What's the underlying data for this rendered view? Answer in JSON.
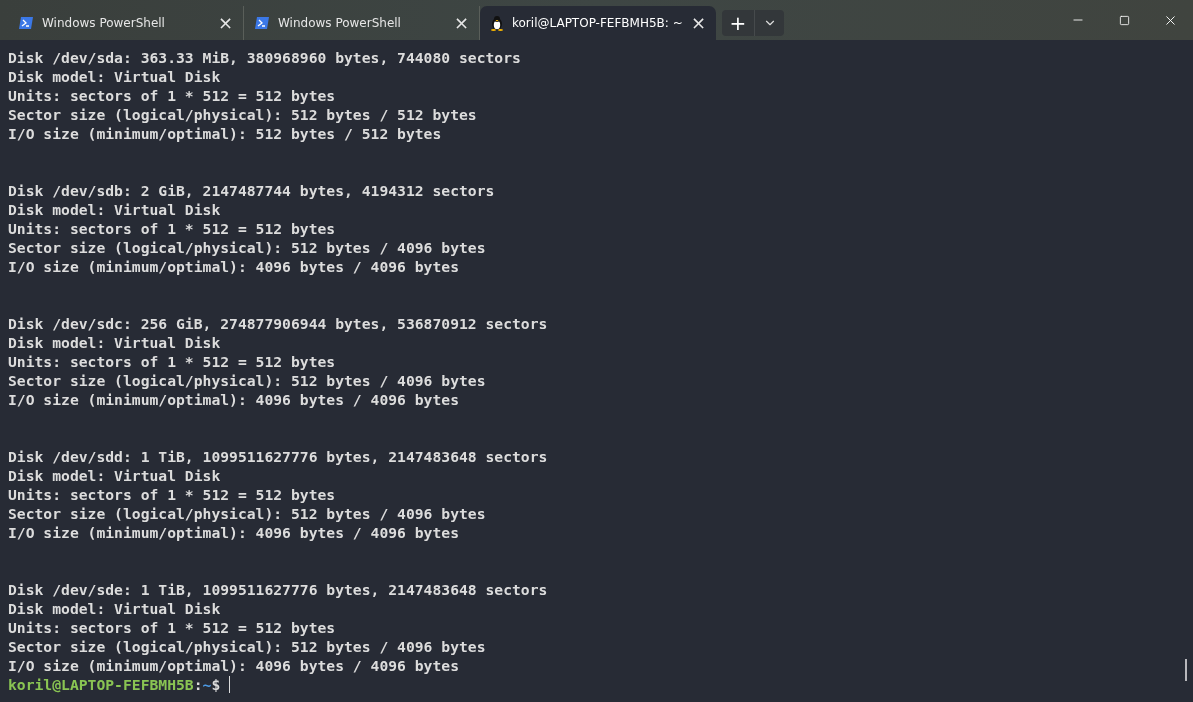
{
  "tabs": [
    {
      "kind": "powershell",
      "label": "Windows PowerShell",
      "selected": false,
      "close": "×"
    },
    {
      "kind": "powershell",
      "label": "Windows PowerShell",
      "selected": false,
      "close": "×"
    },
    {
      "kind": "linux",
      "label": "koril@LAPTOP-FEFBMH5B: ~",
      "selected": true,
      "close": "×"
    }
  ],
  "new_tab": "+",
  "terminal": {
    "blocks": [
      [
        "Disk /dev/sda: 363.33 MiB, 380968960 bytes, 744080 sectors",
        "Disk model: Virtual Disk",
        "Units: sectors of 1 * 512 = 512 bytes",
        "Sector size (logical/physical): 512 bytes / 512 bytes",
        "I/O size (minimum/optimal): 512 bytes / 512 bytes"
      ],
      [
        "Disk /dev/sdb: 2 GiB, 2147487744 bytes, 4194312 sectors",
        "Disk model: Virtual Disk",
        "Units: sectors of 1 * 512 = 512 bytes",
        "Sector size (logical/physical): 512 bytes / 4096 bytes",
        "I/O size (minimum/optimal): 4096 bytes / 4096 bytes"
      ],
      [
        "Disk /dev/sdc: 256 GiB, 274877906944 bytes, 536870912 sectors",
        "Disk model: Virtual Disk",
        "Units: sectors of 1 * 512 = 512 bytes",
        "Sector size (logical/physical): 512 bytes / 4096 bytes",
        "I/O size (minimum/optimal): 4096 bytes / 4096 bytes"
      ],
      [
        "Disk /dev/sdd: 1 TiB, 1099511627776 bytes, 2147483648 sectors",
        "Disk model: Virtual Disk",
        "Units: sectors of 1 * 512 = 512 bytes",
        "Sector size (logical/physical): 512 bytes / 4096 bytes",
        "I/O size (minimum/optimal): 4096 bytes / 4096 bytes"
      ],
      [
        "Disk /dev/sde: 1 TiB, 1099511627776 bytes, 2147483648 sectors",
        "Disk model: Virtual Disk",
        "Units: sectors of 1 * 512 = 512 bytes",
        "Sector size (logical/physical): 512 bytes / 4096 bytes",
        "I/O size (minimum/optimal): 4096 bytes / 4096 bytes"
      ]
    ],
    "prompt": {
      "user_host": "koril@LAPTOP-FEFBMH5B",
      "separator": ":",
      "path": "~",
      "symbol": "$"
    }
  }
}
